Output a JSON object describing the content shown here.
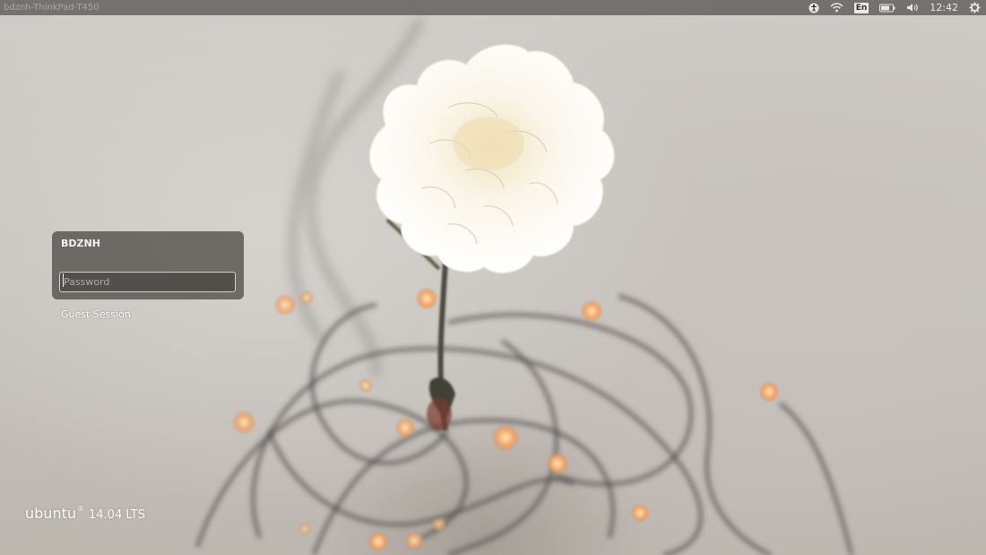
{
  "panel": {
    "hostname": "bdznh-ThinkPad-T450",
    "keyboard_layout": "En",
    "clock": "12:42",
    "icons": {
      "accessibility": "accessibility-icon",
      "network": "wifi-icon",
      "battery": "battery-icon",
      "sound": "volume-icon",
      "session": "gear-icon"
    }
  },
  "login": {
    "user": "BDZNH",
    "password_placeholder": "Password",
    "password_value": "",
    "guest_label": "Guest Session"
  },
  "branding": {
    "name": "ubuntu",
    "registered": "®",
    "version": "14.04 LTS"
  },
  "colors": {
    "panel_bg": "#282828",
    "login_box_bg": "#46423e",
    "text": "#ffffff"
  }
}
